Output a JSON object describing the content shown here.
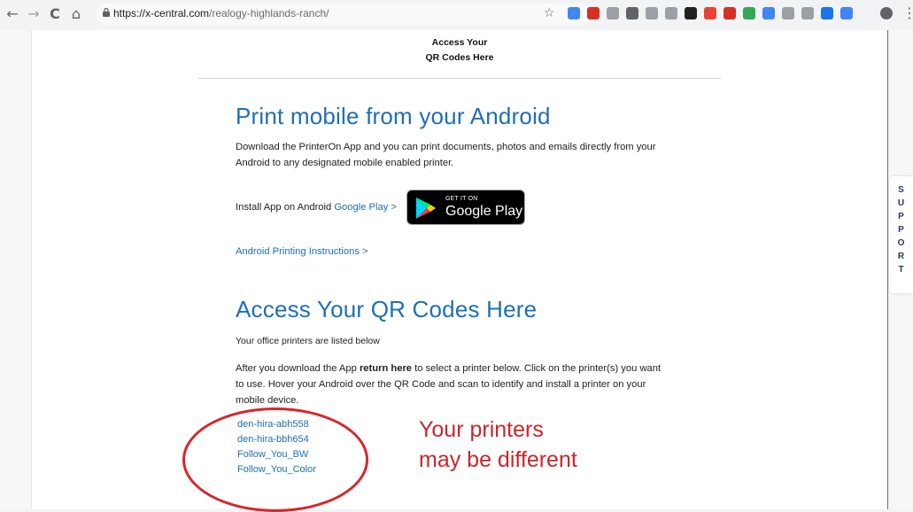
{
  "browser": {
    "nav": {
      "back": "←",
      "forward": "→",
      "reload": "C",
      "home": "⌂"
    },
    "url_host": "https://x-central.com",
    "url_path": "/realogy-highlands-ranch/",
    "bookmark_star": "☆",
    "menu": "⋮",
    "extension_colors": [
      "#4285f4",
      "#d93025",
      "#9aa0a6",
      "#5f6368",
      "#9aa0a6",
      "#9aa0a6",
      "#202124",
      "#ea4335",
      "#d93025",
      "#34a853",
      "#4285f4",
      "#9aa0a6",
      "#9aa0a6",
      "#1a73e8",
      "#4285f4",
      "#5f6368"
    ]
  },
  "header": {
    "line1": "Access Your",
    "line2": "QR Codes Here"
  },
  "android_section": {
    "title": "Print mobile from your Android",
    "description": "Download the PrinterOn App and you can print documents, photos and emails directly from your Android to any designated mobile enabled printer.",
    "install_text": "Install App on Android ",
    "install_link": "Google Play >",
    "badge_small": "GET IT ON",
    "badge_big": "Google Play",
    "instructions_link": "Android Printing Instructions >"
  },
  "qr_section": {
    "title": "Access Your QR Codes Here",
    "intro": "Your office printers are listed below",
    "text_before": "After you download the App ",
    "text_bold": "return here",
    "text_after": "  to select a printer below. Click on the printer(s) you want to use. Hover your Android over the QR Code and scan to identify and install a printer on your mobile device.",
    "printers": [
      "den-hira-abh558",
      "den-hira-bbh654",
      "Follow_You_BW",
      "Follow_You_Color"
    ]
  },
  "annotation": {
    "line1": "Your printers",
    "line2": "may be different",
    "color": "#c9262c"
  },
  "support_tab": {
    "letters": [
      "S",
      "U",
      "P",
      "P",
      "O",
      "R",
      "T"
    ]
  }
}
